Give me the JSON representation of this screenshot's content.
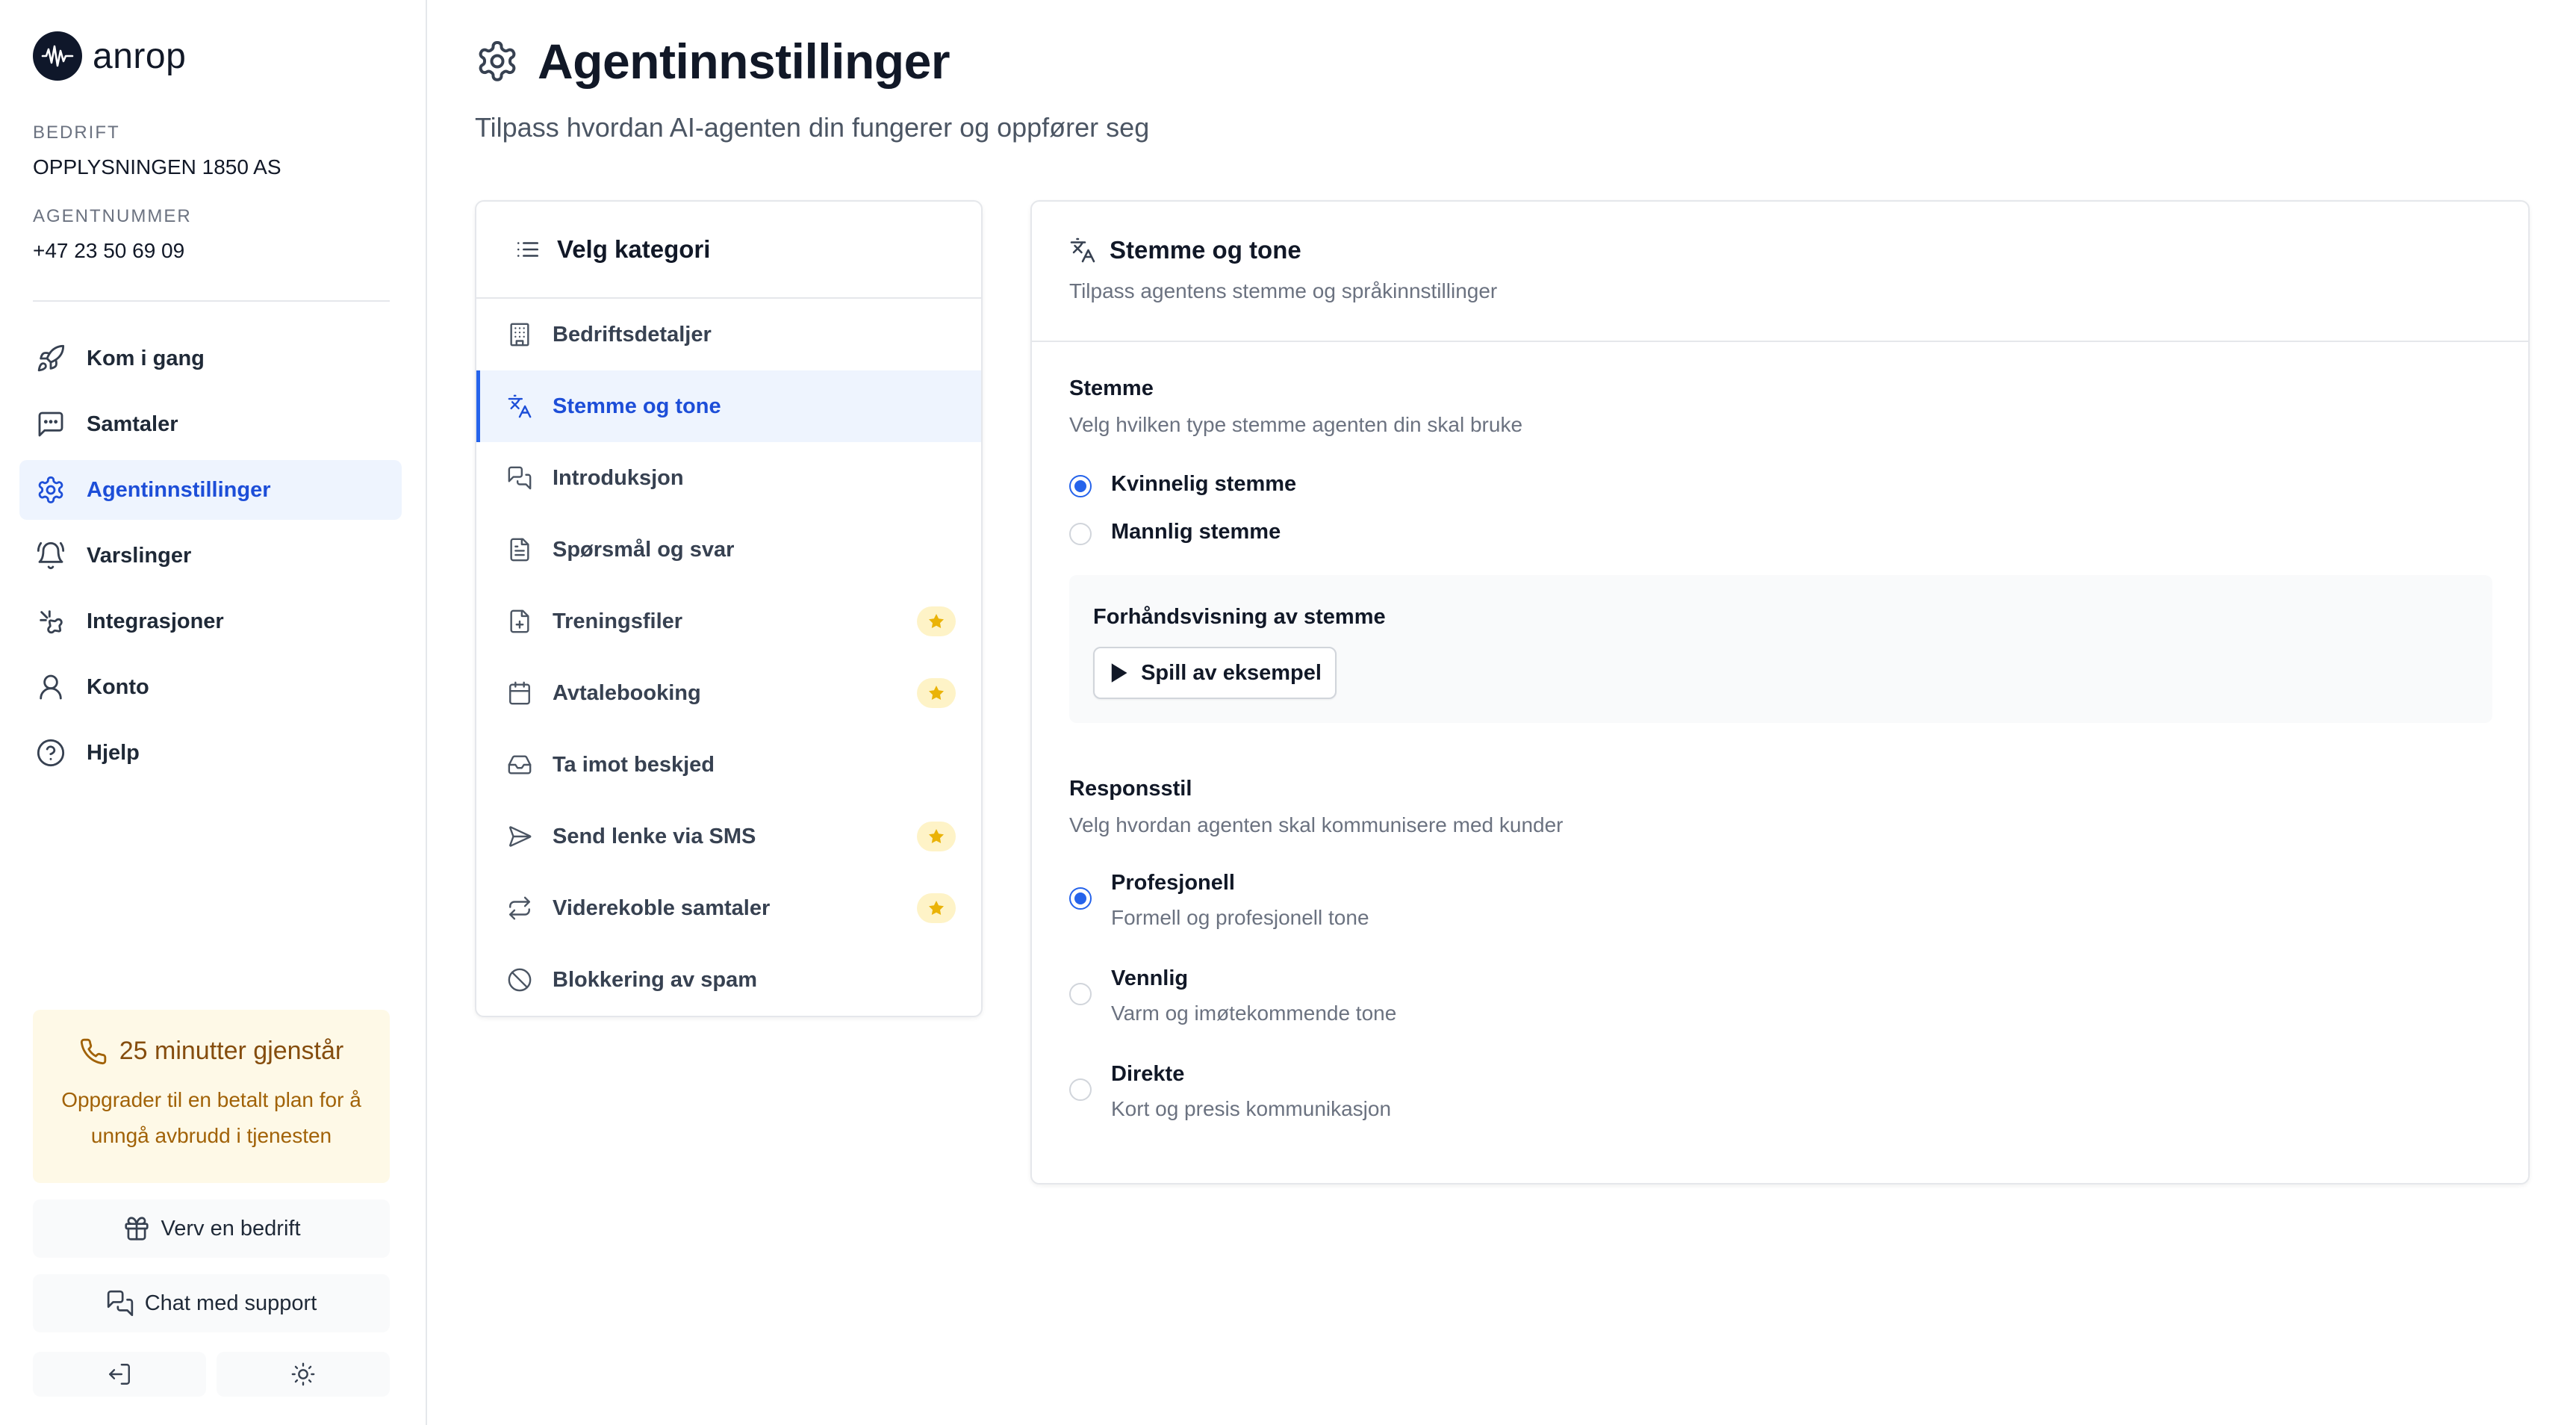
{
  "brand": {
    "name": "anrop"
  },
  "company": {
    "label": "BEDRIFT",
    "value": "OPPLYSNINGEN 1850 AS"
  },
  "agent_number": {
    "label": "AGENTNUMMER",
    "value": "+47 23 50 69 09"
  },
  "nav": [
    {
      "label": "Kom i gang",
      "icon": "rocket-icon"
    },
    {
      "label": "Samtaler",
      "icon": "message-icon"
    },
    {
      "label": "Agentinnstillinger",
      "icon": "gear-icon",
      "active": true
    },
    {
      "label": "Varslinger",
      "icon": "bell-icon"
    },
    {
      "label": "Integrasjoner",
      "icon": "puzzle-icon"
    },
    {
      "label": "Konto",
      "icon": "user-icon"
    },
    {
      "label": "Hjelp",
      "icon": "help-icon"
    }
  ],
  "upgrade": {
    "title": "25 minutter gjenstår",
    "body": "Oppgrader til en betalt plan for å unngå avbrudd i tjenesten"
  },
  "buttons": {
    "refer": "Verv en bedrift",
    "support": "Chat med support"
  },
  "page": {
    "title": "Agentinnstillinger",
    "subtitle": "Tilpass hvordan AI-agenten din fungerer og oppfører seg"
  },
  "categories": {
    "header": "Velg kategori",
    "items": [
      {
        "label": "Bedriftsdetaljer",
        "icon": "building-icon"
      },
      {
        "label": "Stemme og tone",
        "icon": "translate-icon",
        "active": true
      },
      {
        "label": "Introduksjon",
        "icon": "chat-icon"
      },
      {
        "label": "Spørsmål og svar",
        "icon": "file-text-icon"
      },
      {
        "label": "Treningsfiler",
        "icon": "file-plus-icon",
        "premium": true
      },
      {
        "label": "Avtalebooking",
        "icon": "calendar-icon",
        "premium": true
      },
      {
        "label": "Ta imot beskjed",
        "icon": "inbox-icon"
      },
      {
        "label": "Send lenke via SMS",
        "icon": "send-icon",
        "premium": true
      },
      {
        "label": "Viderekoble samtaler",
        "icon": "refresh-icon",
        "premium": true
      },
      {
        "label": "Blokkering av spam",
        "icon": "ban-icon"
      }
    ]
  },
  "settings": {
    "title": "Stemme og tone",
    "description": "Tilpass agentens stemme og språkinnstillinger",
    "voice": {
      "title": "Stemme",
      "description": "Velg hvilken type stemme agenten din skal bruke",
      "options": [
        {
          "label": "Kvinnelig stemme",
          "selected": true
        },
        {
          "label": "Mannlig stemme",
          "selected": false
        }
      ],
      "preview_title": "Forhåndsvisning av stemme",
      "play_label": "Spill av eksempel"
    },
    "response": {
      "title": "Responsstil",
      "description": "Velg hvordan agenten skal kommunisere med kunder",
      "options": [
        {
          "label": "Profesjonell",
          "sub": "Formell og profesjonell tone",
          "selected": true
        },
        {
          "label": "Vennlig",
          "sub": "Varm og imøtekommende tone",
          "selected": false
        },
        {
          "label": "Direkte",
          "sub": "Kort og presis kommunikasjon",
          "selected": false
        }
      ]
    }
  },
  "colors": {
    "accent": "#2563eb",
    "accent_bg": "#eef4fe",
    "warning_bg": "#fef9e7",
    "star": "#eab308"
  }
}
